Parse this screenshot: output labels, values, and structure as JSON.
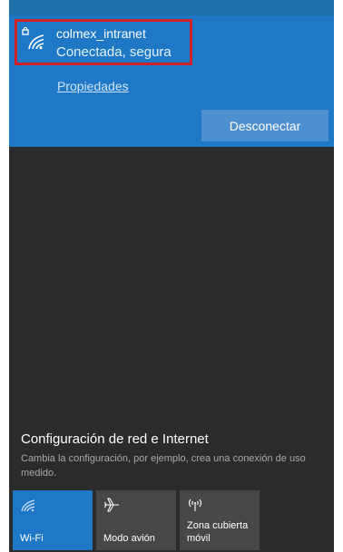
{
  "network": {
    "name": "colmex_intranet",
    "status": "Conectada, segura",
    "properties_link": "Propiedades",
    "disconnect_label": "Desconectar"
  },
  "settings": {
    "title": "Configuración de red e Internet",
    "description": "Cambia la configuración, por ejemplo, crea una conexión de uso medido."
  },
  "quick_actions": [
    {
      "label": "Wi-Fi",
      "icon": "wifi-icon",
      "active": true
    },
    {
      "label": "Modo avión",
      "icon": "airplane-icon",
      "active": false
    },
    {
      "label": "Zona cubierta móvil",
      "icon": "mobile-hotspot-icon",
      "active": false
    }
  ],
  "colors": {
    "accent": "#1f78c6",
    "highlight_border": "#d0202a",
    "panel_background": "#2b2b2b"
  }
}
